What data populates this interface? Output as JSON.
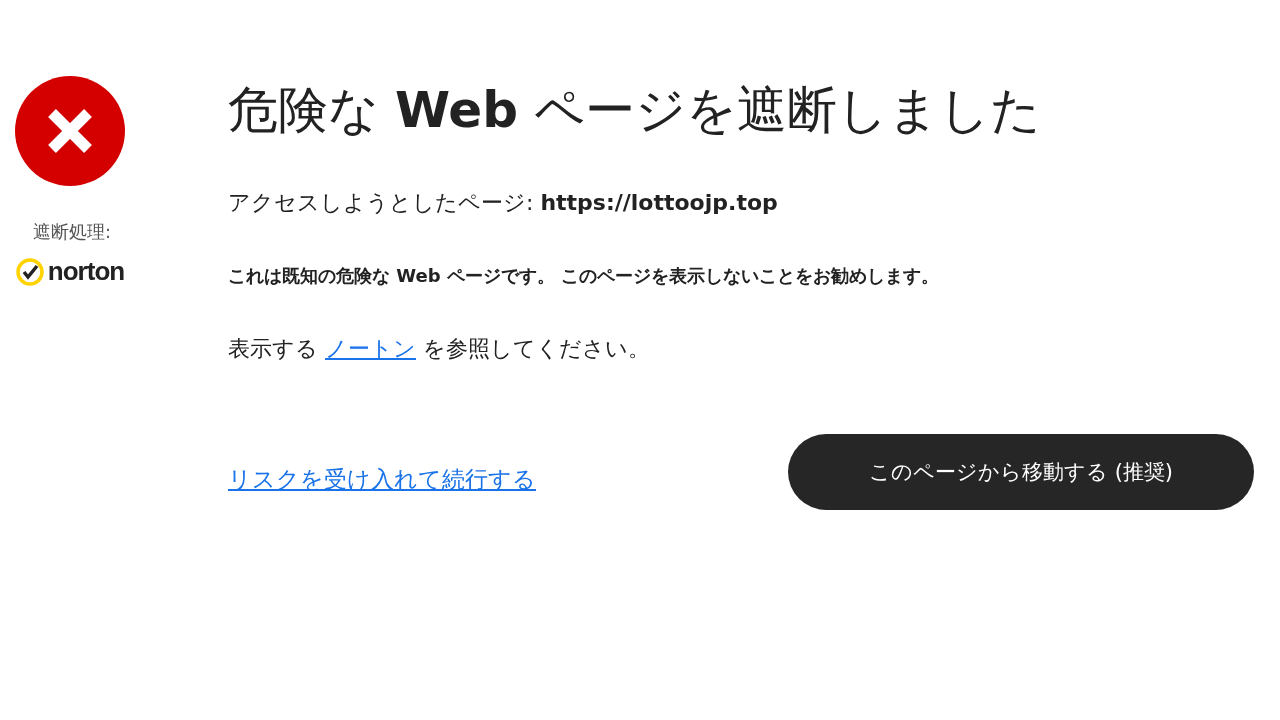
{
  "sidebar": {
    "blocked_by_label": "遮断処理:",
    "brand": "norton"
  },
  "title": "危険な **Web** ページを遮断しました",
  "visited": "アクセスしようとしたページ: **https://lottoojp.top**",
  "warning": "これは既知の危険な Web ページです。 このページを表示しないことをお勧めします。",
  "info": {
    "before": "表示する",
    "link": "ノートン",
    "after": "を参照してください。"
  },
  "actions": {
    "proceed_link": "リスクを受け入れて続行する",
    "leave_button": "このページから移動する (推奨)"
  }
}
